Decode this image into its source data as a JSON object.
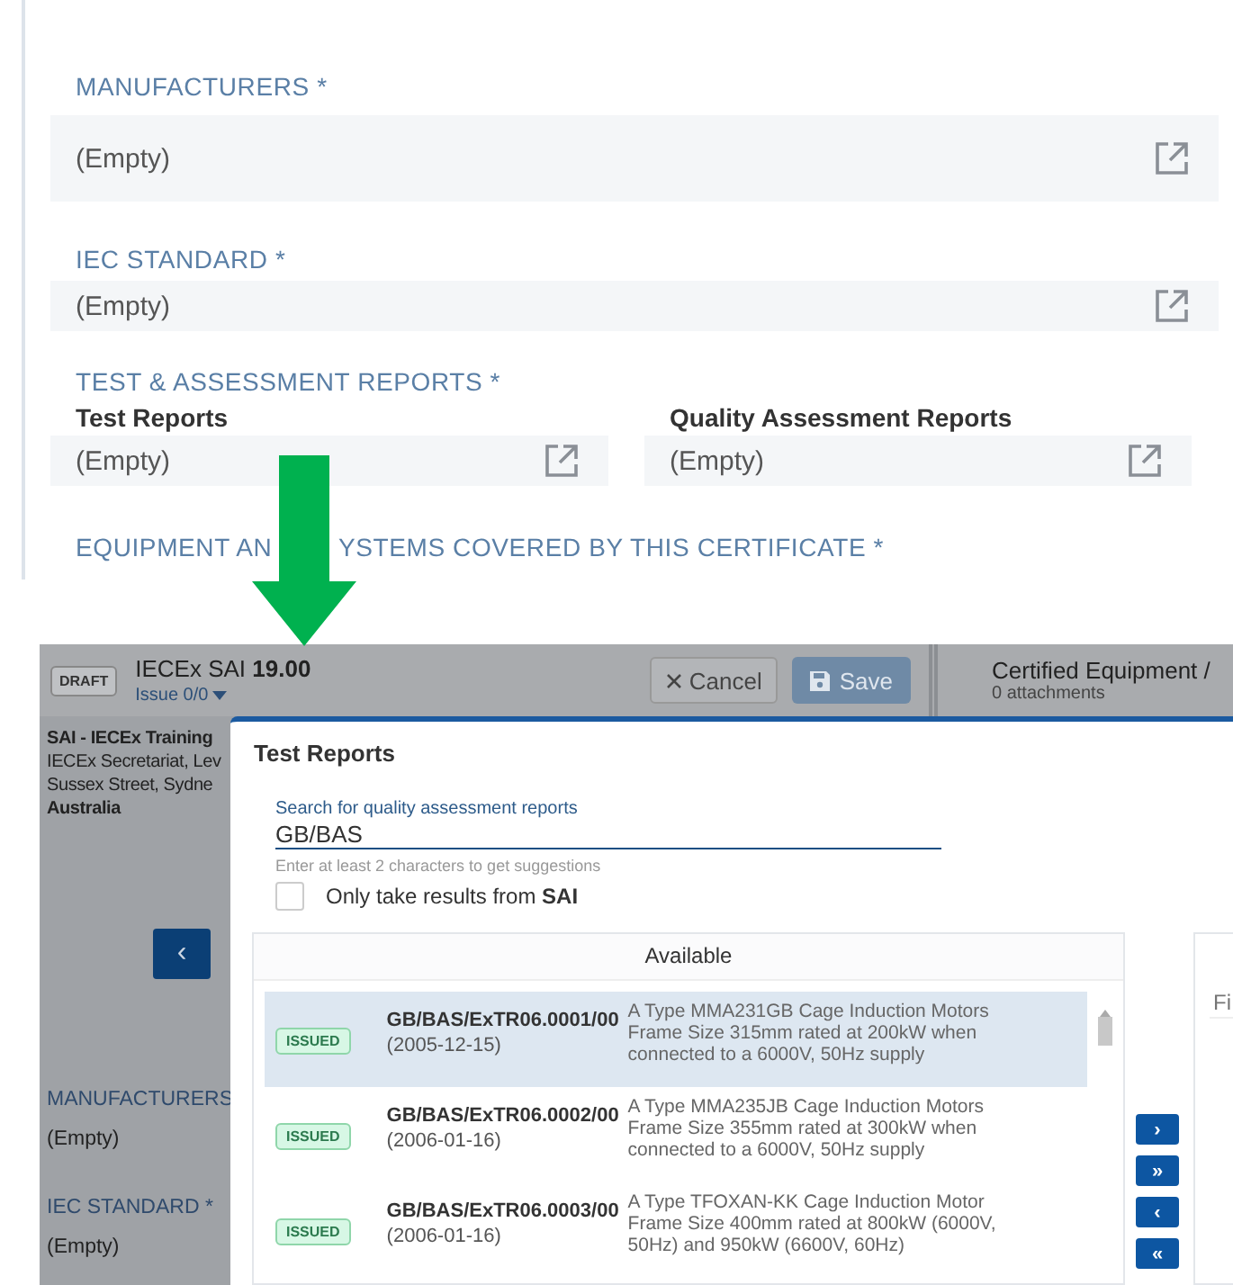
{
  "top_form": {
    "sections": [
      {
        "label": "MANUFACTURERS *",
        "fields": [
          {
            "value": "(Empty)"
          }
        ]
      },
      {
        "label": "IEC STANDARD *",
        "fields": [
          {
            "value": "(Empty)"
          }
        ]
      },
      {
        "label": "TEST & ASSESSMENT REPORTS *",
        "fields": [
          {
            "title": "Test Reports",
            "value": "(Empty)"
          },
          {
            "title": "Quality Assessment Reports",
            "value": "(Empty)"
          }
        ]
      },
      {
        "label_parts": [
          "EQUIPMENT AN",
          "YSTEMS COVERED BY THIS CERTIFICATE *"
        ]
      }
    ]
  },
  "app": {
    "status_badge": "DRAFT",
    "title": "IECEx SAI **19.00**",
    "issue": "Issue 0/0",
    "cancel": "Cancel",
    "save": "Save",
    "panel_title": "Certified Equipment /",
    "attachments": "0 attachments",
    "address": [
      "SAI - IECEx Training",
      "IECEx Secretariat, Lev",
      "Sussex Street, Sydne",
      "Australia"
    ],
    "back_button": "‹",
    "fields": [
      {
        "label": "MANUFACTURERS",
        "value": "(Empty)"
      },
      {
        "label": "IEC STANDARD *",
        "value": "(Empty)"
      }
    ]
  },
  "dialog": {
    "title": "Test Reports",
    "search": {
      "label": "Search for quality assessment reports",
      "value": "GB/BAS",
      "hint": "Enter at least 2 characters to get suggestions"
    },
    "filter": {
      "label": "Only take results from **SAI**",
      "checked": false
    },
    "available": {
      "header": "Available",
      "rows": [
        {
          "status": "ISSUED",
          "code": "GB/BAS/ExTR06.0001/00",
          "date": "(2005-12-15)",
          "description": "A Type MMA231GB Cage Induction Motors Frame Size 315mm rated at 200kW when connected to a 6000V, 50Hz supply",
          "selected": true
        },
        {
          "status": "ISSUED",
          "code": "GB/BAS/ExTR06.0002/00",
          "date": "(2006-01-16)",
          "description": "A Type MMA235JB Cage Induction Motors Frame Size 355mm rated at 300kW when connected to a 6000V, 50Hz supply",
          "selected": false
        },
        {
          "status": "ISSUED",
          "code": "GB/BAS/ExTR06.0003/00",
          "date": "(2006-01-16)",
          "description": "A Type TFOXAN-KK Cage Induction Motor Frame Size 400mm rated at 800kW (6000V, 50Hz) and 950kW (6600V, 60Hz)",
          "selected": false
        }
      ]
    },
    "transfer_buttons": [
      "›",
      "»",
      "‹",
      "«"
    ],
    "selected_filter": {
      "placeholder": "Fi"
    }
  }
}
